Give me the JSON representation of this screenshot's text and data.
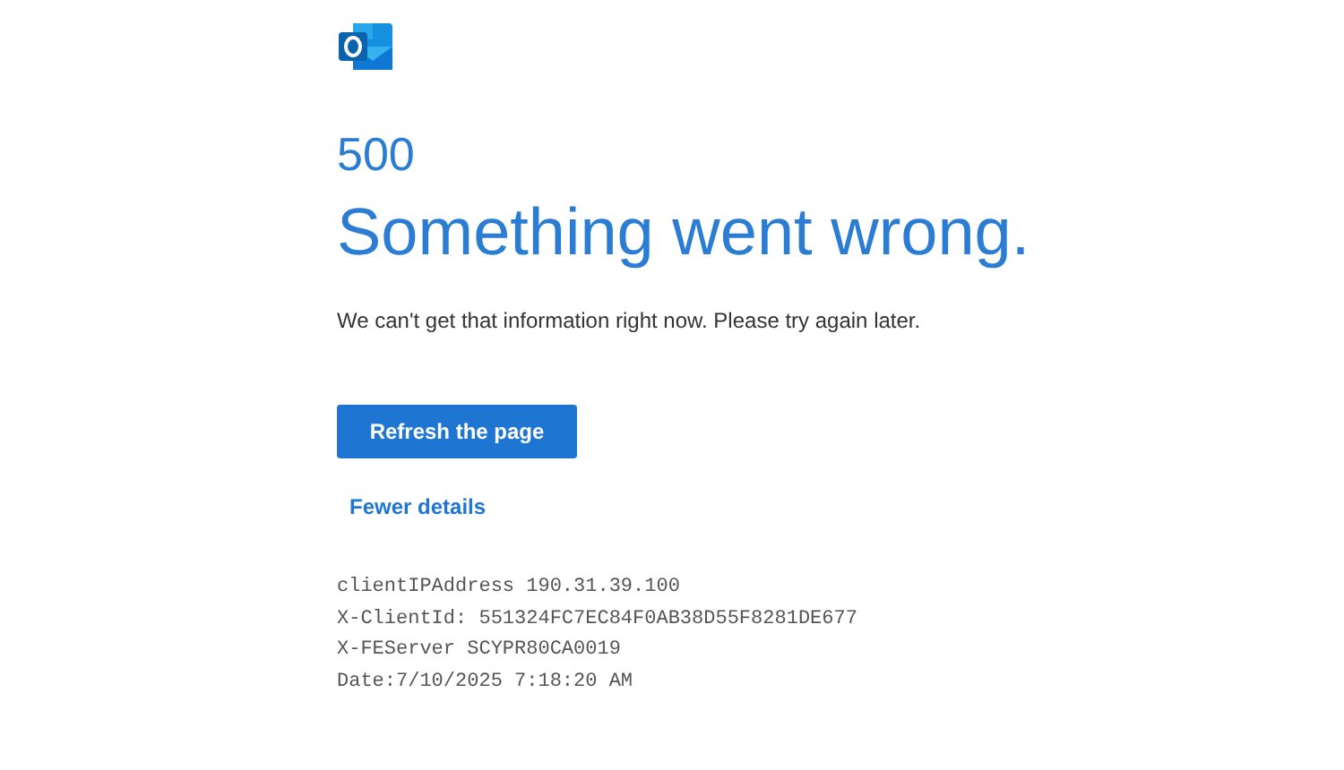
{
  "code": "500",
  "title": "Something went wrong.",
  "message": "We can't get that information right now. Please try again later.",
  "button": "Refresh the page",
  "details_link": "Fewer details",
  "details": [
    "clientIPAddress 190.31.39.100",
    "X-ClientId: 551324FC7EC84F0AB38D55F8281DE677",
    "X-FEServer SCYPR80CA0019",
    "Date:7/10/2025 7:18:20 AM"
  ]
}
